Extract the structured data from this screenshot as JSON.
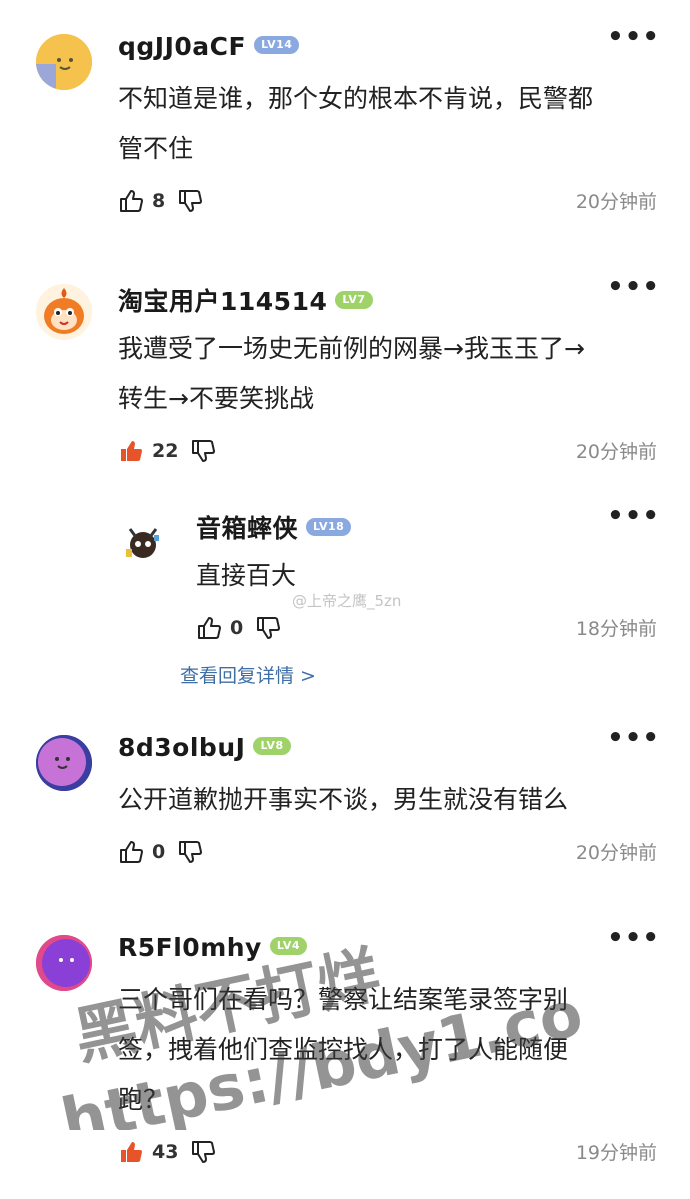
{
  "comments": [
    {
      "username": "qgJJ0aCF",
      "level": "LV14",
      "level_color": "#8aa9e0",
      "text_line1": "不知道是谁，那个女的根本不肯说，民警都",
      "text_line2": "管不住",
      "likes": "8",
      "liked": false,
      "time": "20分钟前"
    },
    {
      "username": "淘宝用户114514",
      "level": "LV7",
      "level_color": "#9fd36a",
      "text_line1": "我遭受了一场史无前例的网暴→我玉玉了→",
      "text_line2": "转生→不要笑挑战",
      "likes": "22",
      "liked": true,
      "time": "20分钟前"
    },
    {
      "username": "音箱蟀侠",
      "level": "LV18",
      "level_color": "#8aa9e0",
      "text_line1": "直接百大",
      "likes": "0",
      "liked": false,
      "time": "18分钟前"
    },
    {
      "username": "8d3olbuJ",
      "level": "LV8",
      "level_color": "#9fd36a",
      "text_line1": "公开道歉抛开事实不谈，男生就没有错么",
      "likes": "0",
      "liked": false,
      "time": "20分钟前"
    },
    {
      "username": "R5Fl0mhy",
      "level": "LV4",
      "level_color": "#9fd36a",
      "text_line1": "三个哥们在看吗？警察让结案笔录签字别",
      "text_line2": "签，拽着他们查监控找人，打了人能随便",
      "text_line3": "跑？",
      "likes": "43",
      "liked": true,
      "time": "19分钟前"
    }
  ],
  "reply_link": "查看回复详情 >",
  "watermark_small": "@上帝之鹰_5zn",
  "watermark_big_line1": "黑料不打烊",
  "watermark_big_line2": "https://bdy1.co",
  "more_glyph": "•••",
  "icons": {
    "like": "thumbs-up-icon",
    "dislike": "thumbs-down-icon",
    "more": "more-icon"
  }
}
